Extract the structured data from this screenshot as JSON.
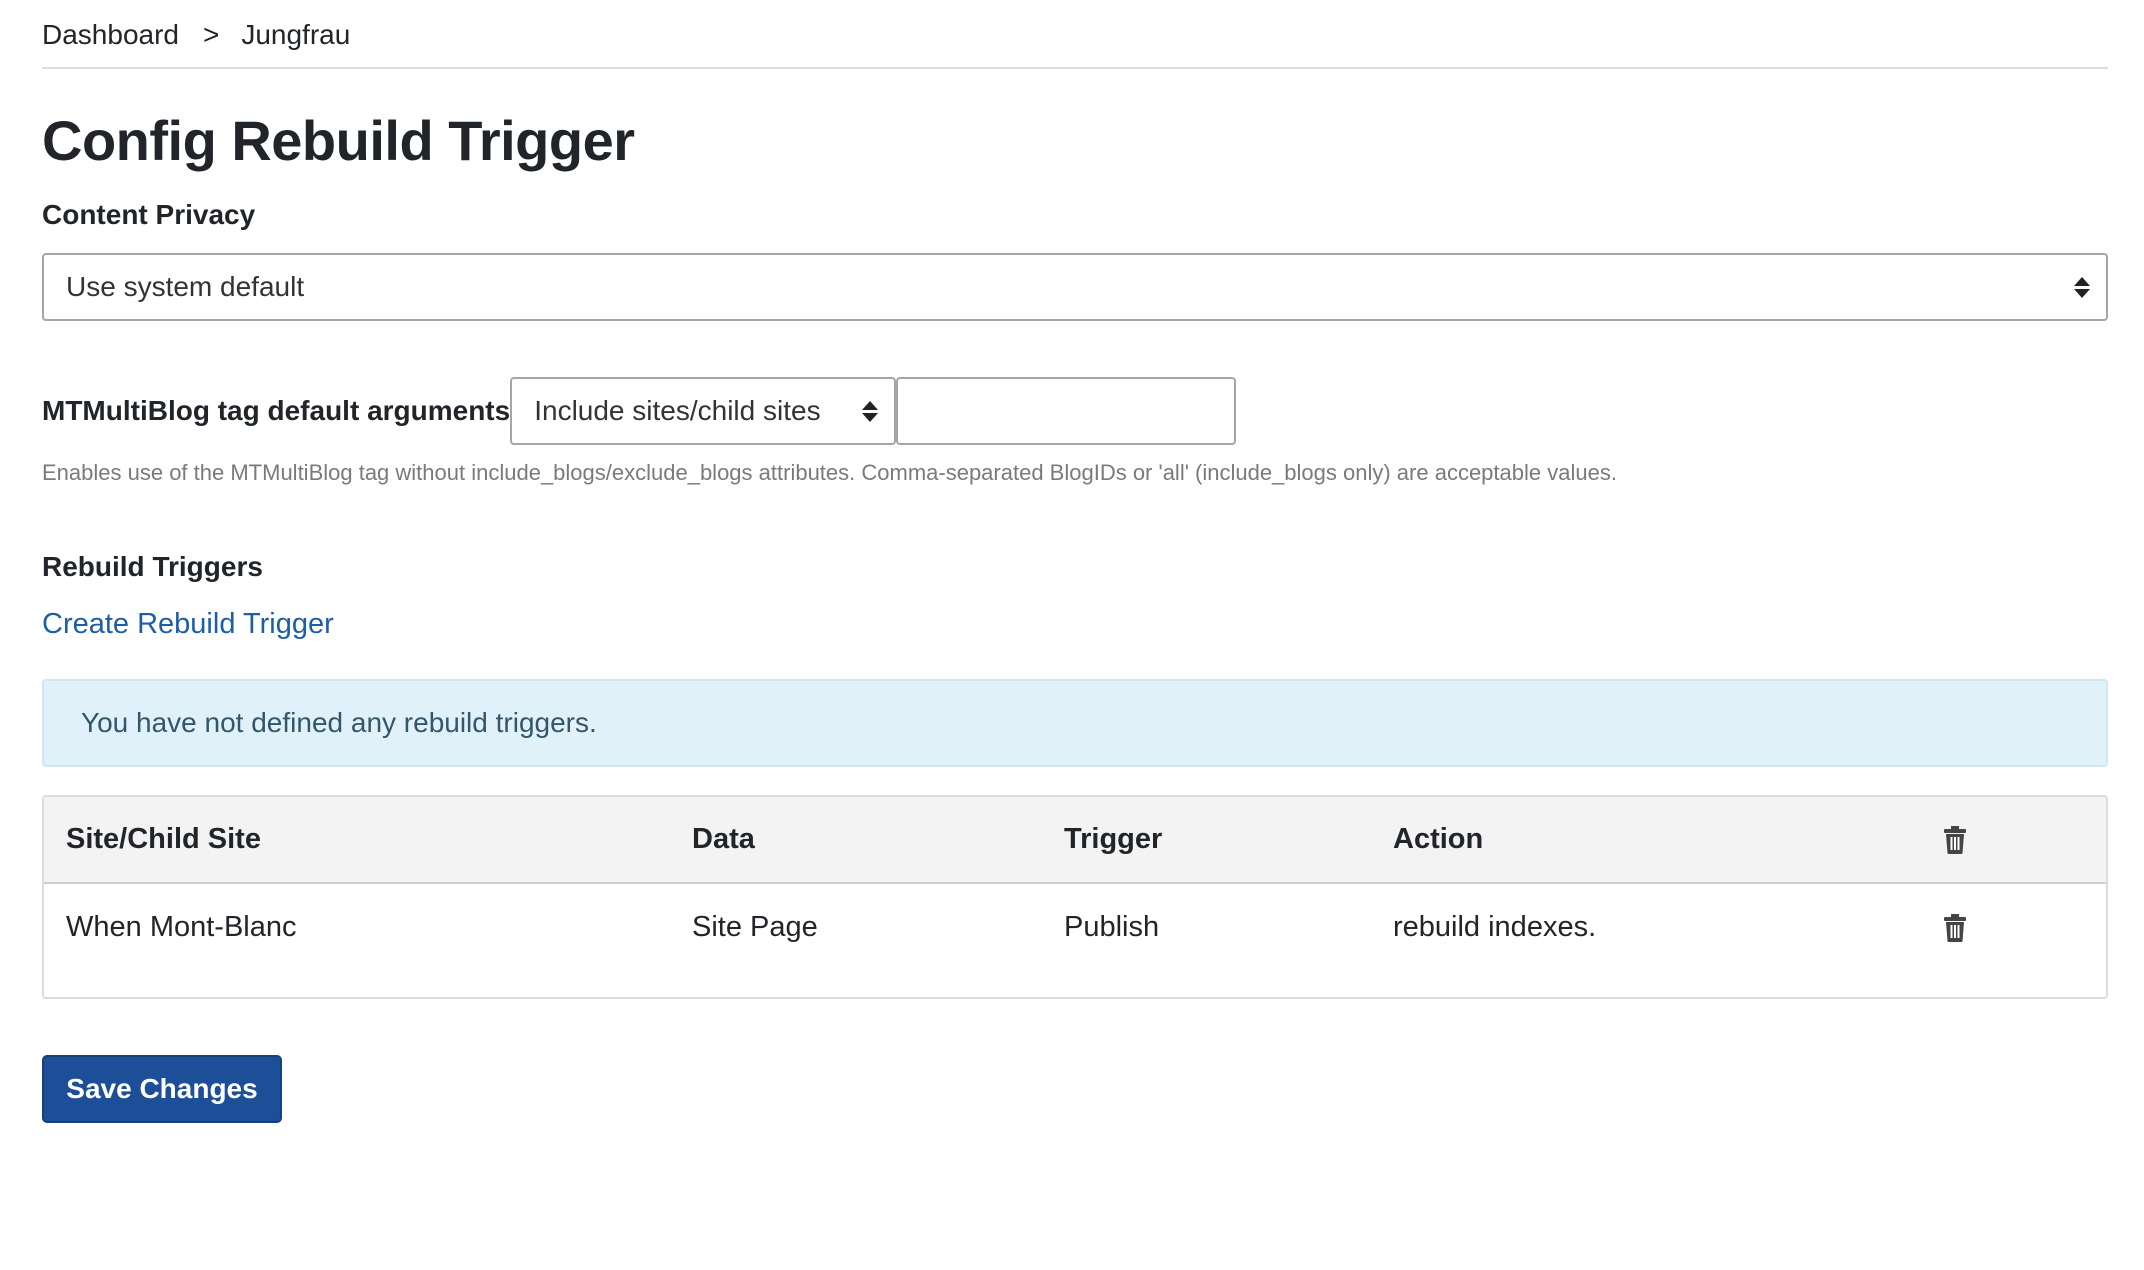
{
  "breadcrumb": {
    "items": [
      "Dashboard",
      "Jungfrau"
    ],
    "separator": ">"
  },
  "page_title": "Config Rebuild Trigger",
  "content_privacy": {
    "label": "Content Privacy",
    "selected": "Use system default"
  },
  "mtmultiblog": {
    "label": "MTMultiBlog tag default arguments",
    "selected": "Include sites/child sites",
    "input_value": "",
    "hint": "Enables use of the MTMultiBlog tag without include_blogs/exclude_blogs attributes. Comma-separated BlogIDs or 'all' (include_blogs only) are acceptable values."
  },
  "rebuild_triggers": {
    "label": "Rebuild Triggers",
    "create_link": "Create Rebuild Trigger",
    "alert": "You have not defined any rebuild triggers."
  },
  "table": {
    "headers": [
      "Site/Child Site",
      "Data",
      "Trigger",
      "Action"
    ],
    "rows": [
      {
        "site": "When Mont-Blanc",
        "data": "Site Page",
        "trigger": "Publish",
        "action": "rebuild indexes."
      }
    ],
    "icons": {
      "delete": "trash-icon"
    }
  },
  "save_button": "Save Changes",
  "colors": {
    "link": "#1c5ea8",
    "button": "#1d4f99",
    "alert_bg": "#e1f1f9"
  }
}
